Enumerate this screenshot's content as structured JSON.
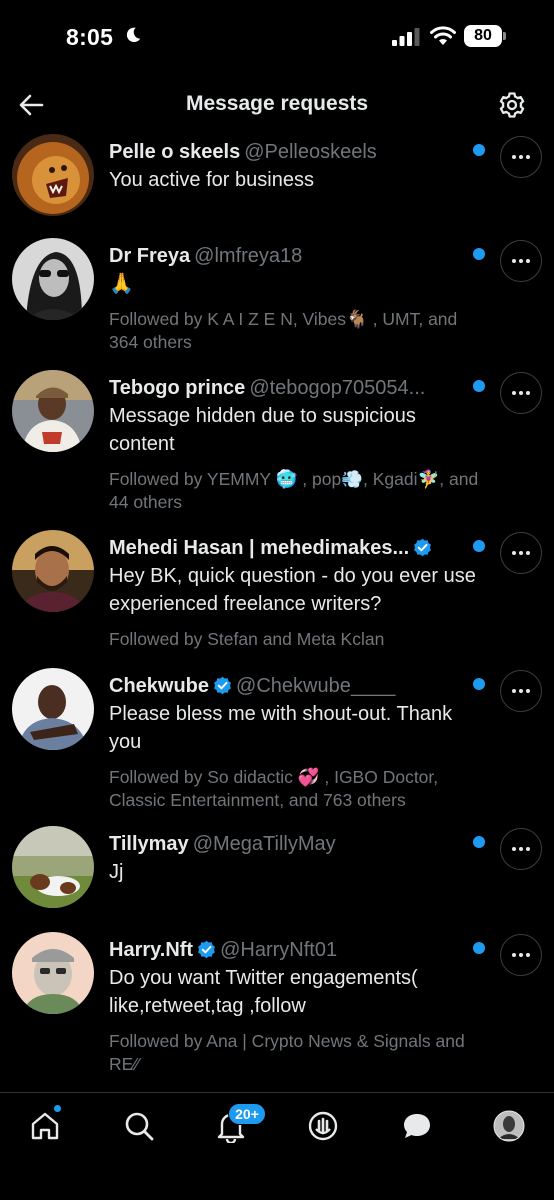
{
  "status_bar": {
    "time": "8:05",
    "battery": "80"
  },
  "header": {
    "title": "Message requests"
  },
  "messages": [
    {
      "name": "Pelle o skeels",
      "handle": "@Pelleoskeels",
      "verified": false,
      "text": "You active for business",
      "followed": "",
      "avatar": "lion"
    },
    {
      "name": "Dr Freya",
      "handle": "@lmfreya18",
      "verified": false,
      "text": "🙏",
      "followed": "Followed by K A I Z E N, Vibes🐐 , UMT, and 364 others",
      "avatar": "bw-woman"
    },
    {
      "name": "Tebogo prince",
      "handle": "@tebogop705054...",
      "verified": false,
      "text": "Message hidden due to suspicious content",
      "followed": "Followed by YEMMY 🥶 , pop💨, Kgadi🧚‍♀️, and 44 others",
      "avatar": "man-cap"
    },
    {
      "name": "Mehedi Hasan | mehedimakes...",
      "handle": "",
      "verified": true,
      "text": "Hey BK, quick question - do you ever use experienced freelance writers?",
      "followed": "Followed by Stefan and Meta Kclan",
      "avatar": "man-beard"
    },
    {
      "name": "Chekwube",
      "handle": "@Chekwube____",
      "verified": true,
      "text": "Please bless me with shout-out. Thank you",
      "followed": "Followed by So didactic 💞 , IGBO Doctor, Classic Entertainment, and 763 others",
      "avatar": "man-white"
    },
    {
      "name": "Tillymay",
      "handle": "@MegaTillyMay",
      "verified": false,
      "text": "Jj",
      "followed": "",
      "avatar": "dog"
    },
    {
      "name": "Harry.Nft",
      "handle": "@HarryNft01",
      "verified": true,
      "text": "Do you want Twitter engagements( like,retweet,tag ,follow",
      "followed": "Followed by Ana | Crypto News & Signals and RE∕∕",
      "avatar": "ape"
    }
  ],
  "tabbar": {
    "notifications_badge": "20+"
  },
  "colors": {
    "accent": "#1d9bf0",
    "background": "#000000",
    "secondary_text": "#71767b",
    "primary_text": "#e7e9ea"
  }
}
